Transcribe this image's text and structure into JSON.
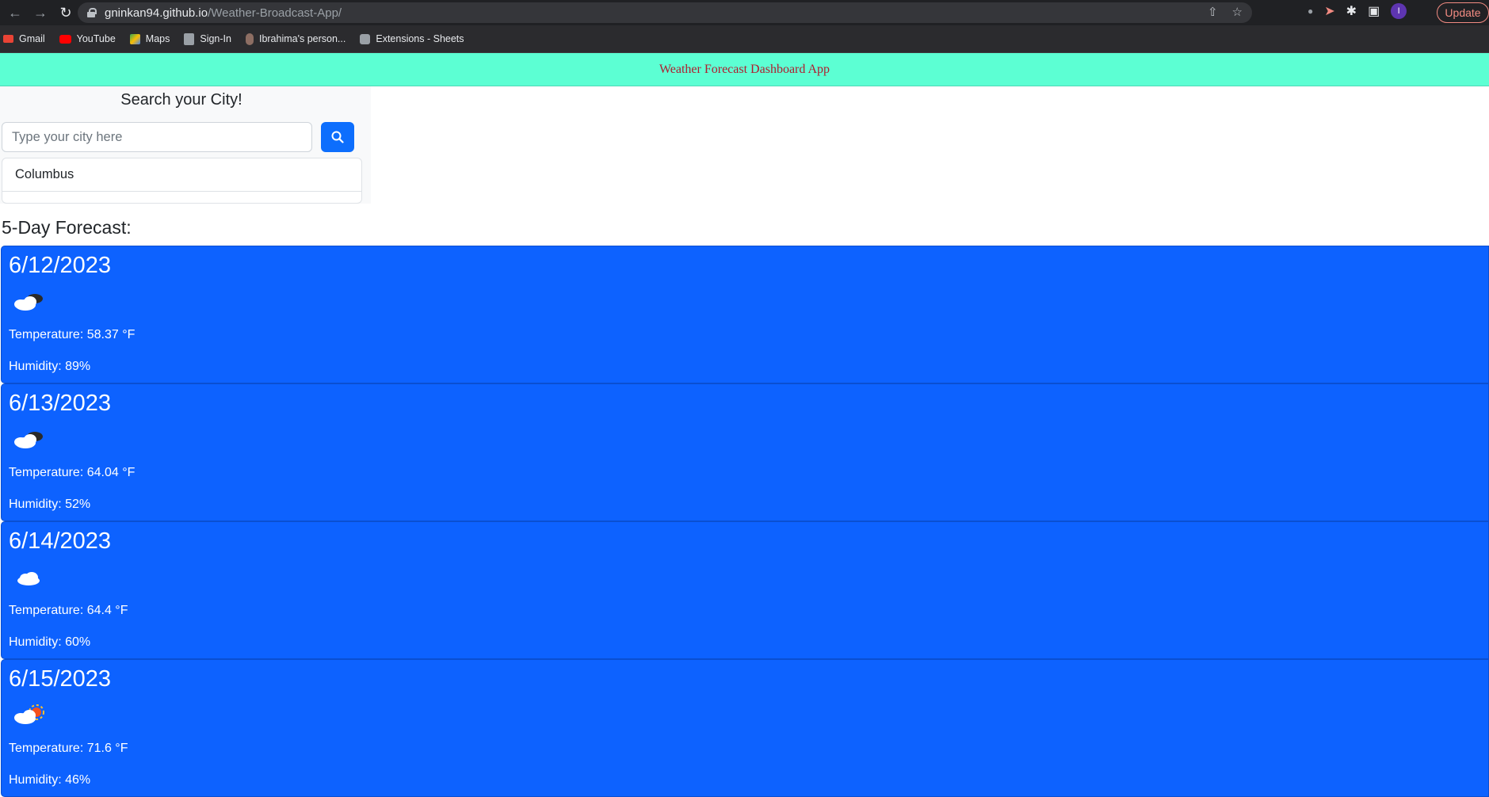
{
  "browser": {
    "url_host": "gninkan94.github.io",
    "url_path": "/Weather-Broadcast-App/",
    "profile_initial": "I",
    "update_label": "Update",
    "bookmarks": [
      {
        "label": "Gmail",
        "icon": "gmail-icon",
        "color": "#ea4335"
      },
      {
        "label": "YouTube",
        "icon": "youtube-icon",
        "color": "#ff0000"
      },
      {
        "label": "Maps",
        "icon": "maps-icon",
        "color": "#34a853"
      },
      {
        "label": "Sign-In",
        "icon": "document-icon",
        "color": "#9aa0a6"
      },
      {
        "label": "Ibrahima's person...",
        "icon": "avatar-icon",
        "color": "#8d6e63"
      },
      {
        "label": "Extensions - Sheets",
        "icon": "puzzle-icon",
        "color": "#9aa0a6"
      }
    ]
  },
  "header": {
    "title": "Weather Forecast Dashboard App",
    "background": "#5cffd3",
    "title_color": "#b01c2e"
  },
  "search": {
    "title": "Search your City!",
    "placeholder": "Type your city here",
    "button_icon": "search-icon",
    "history": [
      "Columbus"
    ]
  },
  "forecast": {
    "heading": "5-Day Forecast:",
    "card_color": "#0d62ff",
    "days": [
      {
        "date": "6/12/2023",
        "icon": "cloud-night-icon",
        "temperature": "Temperature: 58.37 °F",
        "humidity": "Humidity: 89%"
      },
      {
        "date": "6/13/2023",
        "icon": "cloud-night-icon",
        "temperature": "Temperature: 64.04 °F",
        "humidity": "Humidity: 52%"
      },
      {
        "date": "6/14/2023",
        "icon": "cloud-icon",
        "temperature": "Temperature: 64.4 °F",
        "humidity": "Humidity: 60%"
      },
      {
        "date": "6/15/2023",
        "icon": "cloud-sun-icon",
        "temperature": "Temperature: 71.6 °F",
        "humidity": "Humidity: 46%"
      }
    ]
  }
}
